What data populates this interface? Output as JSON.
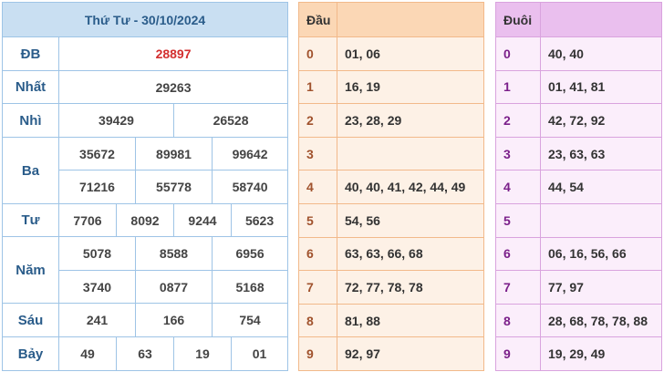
{
  "results": {
    "title": "Thứ Tư - 30/10/2024",
    "labels": {
      "db": "ĐB",
      "nhat": "Nhất",
      "nhi": "Nhì",
      "ba": "Ba",
      "tu": "Tư",
      "nam": "Năm",
      "sau": "Sáu",
      "bay": "Bảy"
    },
    "db": "28897",
    "nhat": "29263",
    "nhi": [
      "39429",
      "26528"
    ],
    "ba": [
      "35672",
      "89981",
      "99642",
      "71216",
      "55778",
      "58740"
    ],
    "tu": [
      "7706",
      "8092",
      "9244",
      "5623"
    ],
    "nam": [
      "5078",
      "8588",
      "6956",
      "3740",
      "0877",
      "5168"
    ],
    "sau": [
      "241",
      "166",
      "754"
    ],
    "bay": [
      "49",
      "63",
      "19",
      "01"
    ],
    "accent_red": "#d32f2f"
  },
  "dau": {
    "header": "Đầu",
    "rows": [
      {
        "digit": "0",
        "values": "01, 06"
      },
      {
        "digit": "1",
        "values": "16, 19"
      },
      {
        "digit": "2",
        "values": "23, 28, 29"
      },
      {
        "digit": "3",
        "values": ""
      },
      {
        "digit": "4",
        "values": "40, 40, 41, 42, 44, 49"
      },
      {
        "digit": "5",
        "values": "54, 56"
      },
      {
        "digit": "6",
        "values": "63, 63, 66, 68"
      },
      {
        "digit": "7",
        "values": "72, 77, 78, 78"
      },
      {
        "digit": "8",
        "values": "81, 88"
      },
      {
        "digit": "9",
        "values": "92, 97"
      }
    ]
  },
  "duoi": {
    "header": "Đuôi",
    "rows": [
      {
        "digit": "0",
        "values": "40, 40"
      },
      {
        "digit": "1",
        "values": "01, 41, 81"
      },
      {
        "digit": "2",
        "values": "42, 72, 92"
      },
      {
        "digit": "3",
        "values": "23, 63, 63"
      },
      {
        "digit": "4",
        "values": "44, 54"
      },
      {
        "digit": "5",
        "values": ""
      },
      {
        "digit": "6",
        "values": "06, 16, 56, 66"
      },
      {
        "digit": "7",
        "values": "77, 97"
      },
      {
        "digit": "8",
        "values": "28, 68, 78, 78, 88"
      },
      {
        "digit": "9",
        "values": "19, 29, 49"
      }
    ]
  }
}
